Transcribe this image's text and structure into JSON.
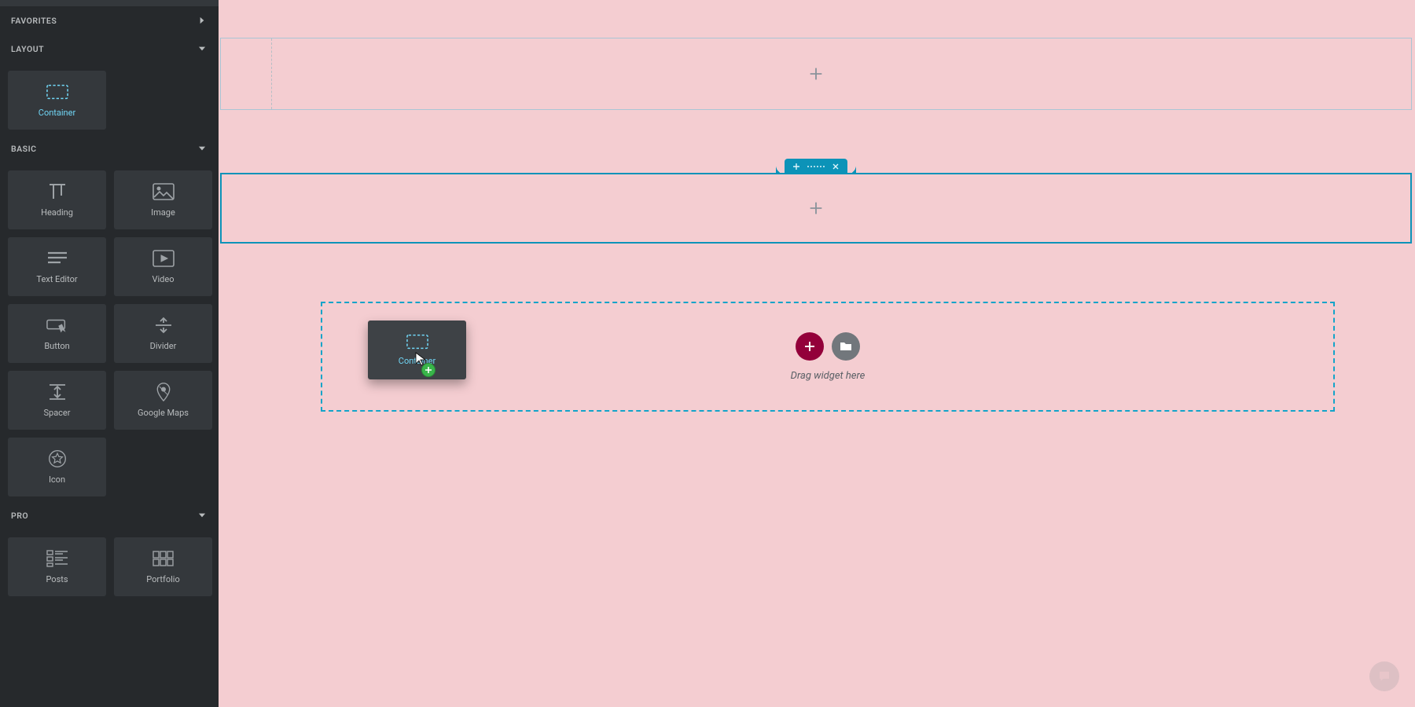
{
  "sidebar": {
    "categories": {
      "favorites": "FAVORITES",
      "layout": "LAYOUT",
      "basic": "BASIC",
      "pro": "PRO"
    },
    "widgets": {
      "container": "Container",
      "heading": "Heading",
      "image": "Image",
      "text_editor": "Text Editor",
      "video": "Video",
      "button": "Button",
      "divider": "Divider",
      "spacer": "Spacer",
      "google_maps": "Google Maps",
      "icon": "Icon",
      "posts": "Posts",
      "portfolio": "Portfolio"
    }
  },
  "canvas": {
    "drop_zone_text": "Drag widget here"
  },
  "drag_ghost": {
    "label": "Container"
  },
  "colors": {
    "accent": "#0c93b8",
    "canvas_bg": "#f4cdd1",
    "sidebar_bg": "#26292c",
    "tile_bg": "#34383c",
    "add_btn": "#93003a"
  }
}
